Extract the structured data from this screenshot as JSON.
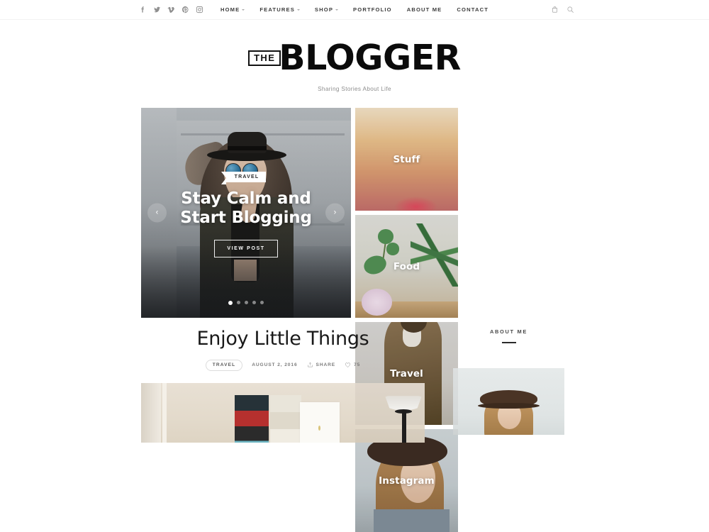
{
  "header": {
    "social": [
      {
        "name": "facebook-icon",
        "label": "Facebook"
      },
      {
        "name": "twitter-icon",
        "label": "Twitter"
      },
      {
        "name": "vimeo-icon",
        "label": "Vimeo"
      },
      {
        "name": "pinterest-icon",
        "label": "Pinterest"
      },
      {
        "name": "instagram-icon",
        "label": "Instagram"
      }
    ],
    "nav": [
      {
        "label": "HOME",
        "has_caret": true
      },
      {
        "label": "FEATURES",
        "has_caret": true
      },
      {
        "label": "SHOP",
        "has_caret": true
      },
      {
        "label": "PORTFOLIO",
        "has_caret": false
      },
      {
        "label": "ABOUT ME",
        "has_caret": false
      },
      {
        "label": "CONTACT",
        "has_caret": false
      }
    ],
    "cart_icon": "shopping-bag-icon",
    "search_icon": "search-icon"
  },
  "logo": {
    "the": "THE",
    "main": "BLOGGER",
    "tagline": "Sharing Stories About Life"
  },
  "slider": {
    "category": "TRAVEL",
    "title_line1": "Stay Calm and",
    "title_line2": "Start Blogging",
    "button": "VIEW POST",
    "prev": "‹",
    "next": "›",
    "dots": 5,
    "active_dot": 1
  },
  "tiles": [
    {
      "label": "Stuff"
    },
    {
      "label": "Food"
    },
    {
      "label": "Travel"
    },
    {
      "label": "Instagram"
    }
  ],
  "post": {
    "title": "Enjoy Little Things",
    "category": "TRAVEL",
    "date": "AUGUST 2, 2016",
    "share": "SHARE",
    "likes": "75"
  },
  "sidebar": {
    "title": "ABOUT ME"
  },
  "colors": {
    "text": "#2b2b2b",
    "muted": "#8d8d8d",
    "border": "#f2f2f2",
    "accent": "#111111"
  }
}
